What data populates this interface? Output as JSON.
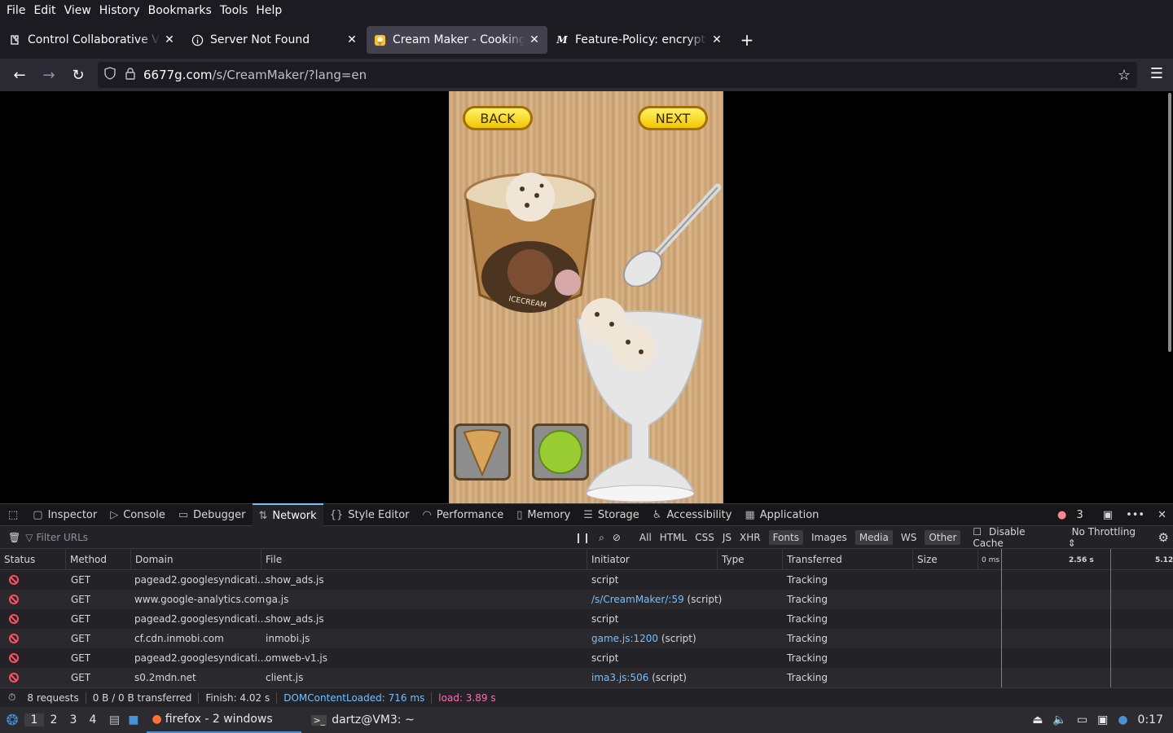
{
  "menubar": {
    "items": [
      "File",
      "Edit",
      "View",
      "History",
      "Bookmarks",
      "Tools",
      "Help"
    ]
  },
  "tabs": [
    {
      "label": "Control Collaborative Virt",
      "icon": "puzzle-icon",
      "active": false
    },
    {
      "label": "Server Not Found",
      "icon": "info-icon",
      "active": false
    },
    {
      "label": "Cream Maker - Cooking G",
      "icon": "game-icon",
      "active": true
    },
    {
      "label": "Feature-Policy: encrypted",
      "icon": "mdn-icon",
      "active": false
    }
  ],
  "nav": {
    "url_host": "6677g.com",
    "url_path": "/s/CreamMaker/?lang=en"
  },
  "game": {
    "back_label": "BACK",
    "next_label": "NEXT",
    "tub_label": "ICECREAM"
  },
  "devtools": {
    "tabs": [
      "Inspector",
      "Console",
      "Debugger",
      "Network",
      "Style Editor",
      "Performance",
      "Memory",
      "Storage",
      "Accessibility",
      "Application"
    ],
    "selected_tab": "Network",
    "error_count": "3",
    "filter_placeholder": "Filter URLs",
    "type_filters": [
      "All",
      "HTML",
      "CSS",
      "JS",
      "XHR",
      "Fonts",
      "Images",
      "Media",
      "WS",
      "Other"
    ],
    "active_filters": [
      "Fonts",
      "Media",
      "Other"
    ],
    "disable_cache_label": "Disable Cache",
    "throttling_label": "No Throttling",
    "columns": [
      "Status",
      "Method",
      "Domain",
      "File",
      "Initiator",
      "Type",
      "Transferred",
      "Size"
    ],
    "timeline_ticks": [
      "0 ms",
      "2.56 s",
      "5.12"
    ],
    "requests": [
      {
        "method": "GET",
        "domain": "pagead2.googlesyndicati...",
        "file": "show_ads.js",
        "initiator": "script",
        "initiator_link": "",
        "transferred": "Tracking"
      },
      {
        "method": "GET",
        "domain": "www.google-analytics.com",
        "file": "ga.js",
        "initiator": "(script)",
        "initiator_link": "/s/CreamMaker/:59",
        "transferred": "Tracking"
      },
      {
        "method": "GET",
        "domain": "pagead2.googlesyndicati...",
        "file": "show_ads.js",
        "initiator": "script",
        "initiator_link": "",
        "transferred": "Tracking"
      },
      {
        "method": "GET",
        "domain": "cf.cdn.inmobi.com",
        "file": "inmobi.js",
        "initiator": "(script)",
        "initiator_link": "game.js:1200",
        "transferred": "Tracking"
      },
      {
        "method": "GET",
        "domain": "pagead2.googlesyndicati...",
        "file": "omweb-v1.js",
        "initiator": "script",
        "initiator_link": "",
        "transferred": "Tracking"
      },
      {
        "method": "GET",
        "domain": "s0.2mdn.net",
        "file": "client.js",
        "initiator": "(script)",
        "initiator_link": "ima3.js:506",
        "transferred": "Tracking"
      }
    ],
    "status": {
      "requests": "8 requests",
      "transferred": "0 B / 0 B transferred",
      "finish": "Finish: 4.02 s",
      "dcl": "DOMContentLoaded: 716 ms",
      "load": "load: 3.89 s"
    },
    "colors": {
      "dcl": "#75bfff",
      "load": "#ff6bba",
      "blocked": "#ff4f5e"
    }
  },
  "taskbar": {
    "workspaces": [
      "1",
      "2",
      "3",
      "4"
    ],
    "current_workspace": "1",
    "tasks": [
      {
        "label": "firefox - 2 windows",
        "icon": "firefox-icon"
      },
      {
        "label": "dartz@VM3: ~",
        "icon": "terminal-icon"
      }
    ],
    "clock": "0:17"
  }
}
